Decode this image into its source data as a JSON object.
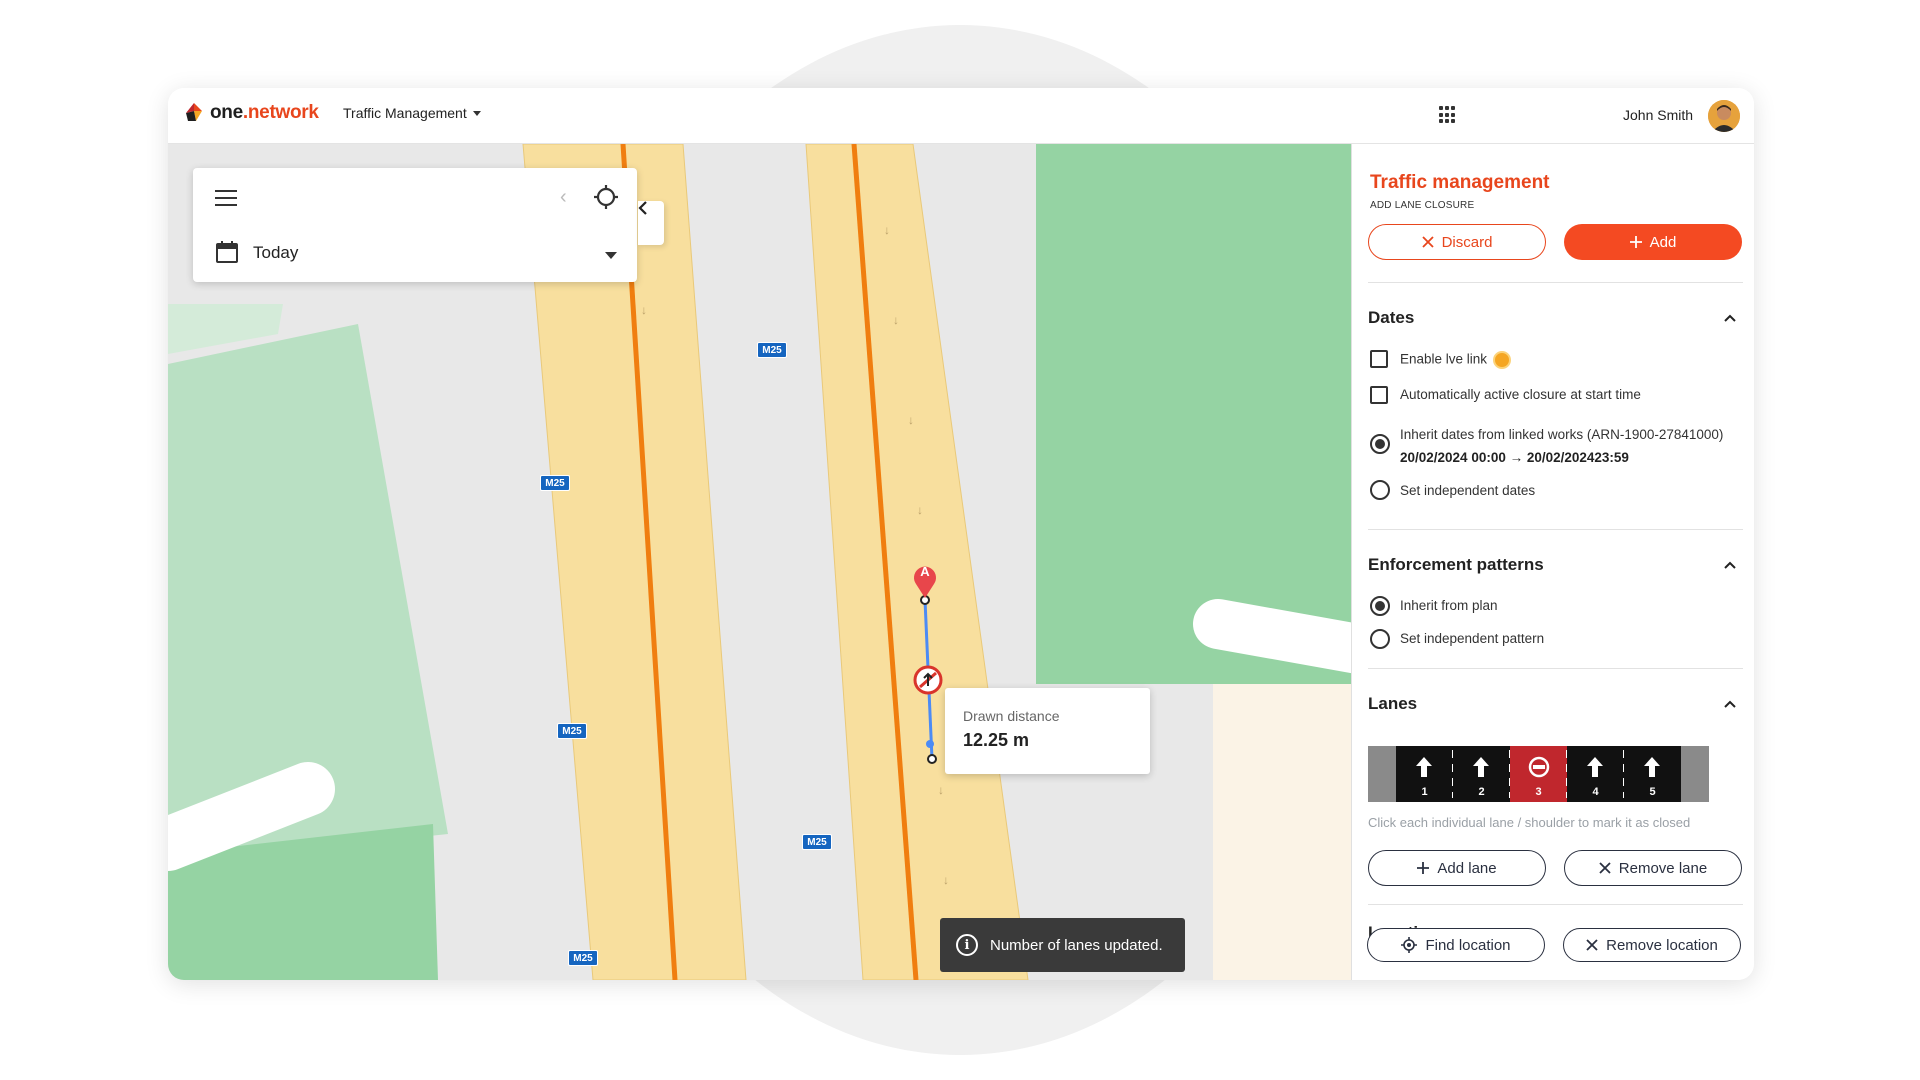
{
  "header": {
    "logo_one": "one",
    "logo_network": ".network",
    "app_switcher": "Traffic Management",
    "user_name": "John Smith"
  },
  "map": {
    "date_filter": "Today",
    "road_shield": "M25",
    "marker_a": "A",
    "distance_label": "Drawn distance",
    "distance_value": "12.25 m",
    "toast": "Number of lanes updated."
  },
  "panel": {
    "title": "Traffic management",
    "subtitle": "ADD LANE CLOSURE",
    "discard_label": "Discard",
    "add_label": "Add",
    "dates": {
      "heading": "Dates",
      "enable_live_link": "Enable lve link",
      "auto_activate": "Automatically active closure at start time",
      "inherit_label": "Inherit dates from linked works (ARN-1900-27841000)",
      "inherit_range": "20/02/2024 00:00 → 20/02/202423:59",
      "independent": "Set independent dates"
    },
    "enforcement": {
      "heading": "Enforcement patterns",
      "inherit": "Inherit from plan",
      "independent": "Set independent pattern"
    },
    "lanes": {
      "heading": "Lanes",
      "items": [
        {
          "num": "1",
          "closed": false
        },
        {
          "num": "2",
          "closed": false
        },
        {
          "num": "3",
          "closed": true
        },
        {
          "num": "4",
          "closed": false
        },
        {
          "num": "5",
          "closed": false
        }
      ],
      "hint": "Click each individual lane / shoulder to mark it as closed",
      "add_lane": "Add lane",
      "remove_lane": "Remove lane"
    },
    "location": {
      "heading": "Location",
      "find": "Find location",
      "remove": "Remove location"
    }
  },
  "colors": {
    "brand": "#e8461d",
    "road_fill": "#f8df9e",
    "road_line": "#f07e10",
    "park": "#95d3a3",
    "lane_closed": "#c0272d"
  }
}
